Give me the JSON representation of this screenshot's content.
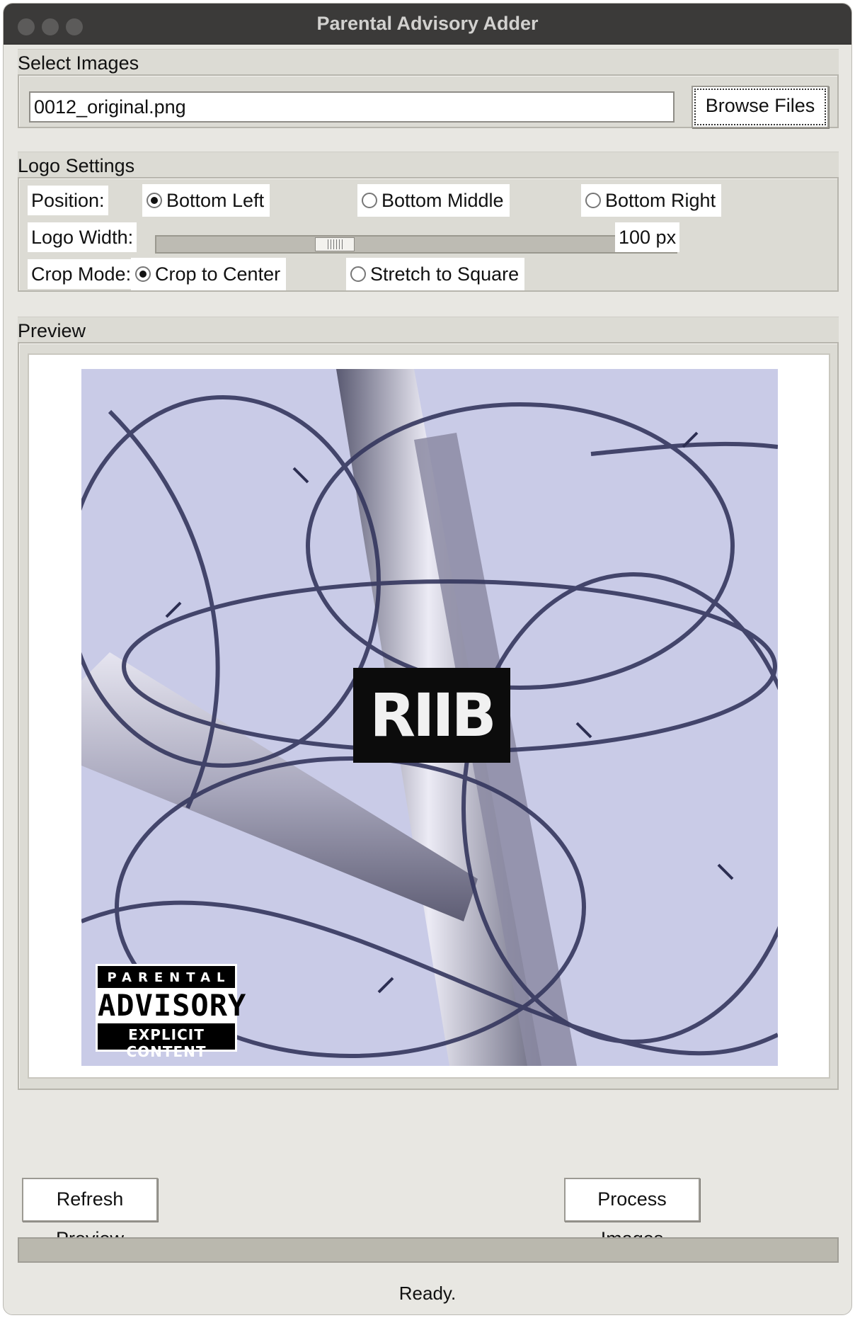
{
  "window": {
    "title": "Parental Advisory Adder"
  },
  "select_images": {
    "header": "Select Images",
    "file_value": "0012_original.png",
    "browse_label": "Browse Files"
  },
  "logo_settings": {
    "header": "Logo Settings",
    "position_label": "Position:",
    "positions": [
      "Bottom Left",
      "Bottom Middle",
      "Bottom Right"
    ],
    "position_selected": "Bottom Left",
    "width_label": "Logo Width:",
    "width_value": "100 px",
    "crop_label": "Crop Mode:",
    "crop_modes": [
      "Crop to Center",
      "Stretch to Square"
    ],
    "crop_selected": "Crop to Center"
  },
  "preview": {
    "header": "Preview",
    "image_logo_text": "RIIB",
    "badge": {
      "top": "PARENTAL",
      "middle": "ADVISORY",
      "bottom": "EXPLICIT CONTENT"
    }
  },
  "actions": {
    "refresh_label": "Refresh Preview",
    "process_label": "Process Images"
  },
  "status": {
    "text": "Ready.",
    "progress": 0
  }
}
